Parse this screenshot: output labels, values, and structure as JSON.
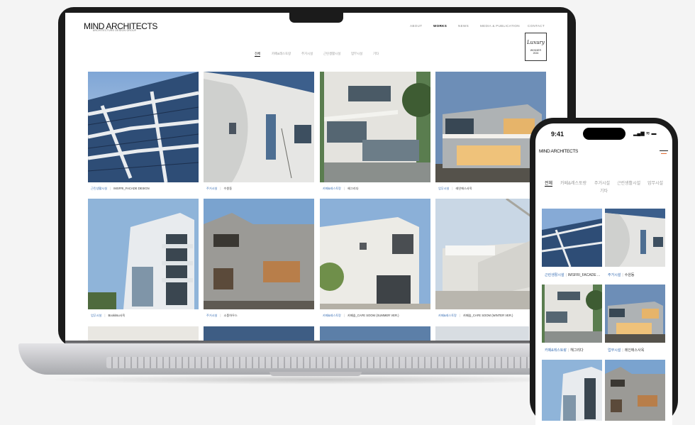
{
  "site": {
    "logo": "MIND ARCHITECTS",
    "logo_sub": "ARCHITECTURE DESIGN GROUP",
    "nav": [
      "ABOUT",
      "WORKS",
      "NEWS",
      "MEDIA & PUBLICATION",
      "CONTACT"
    ],
    "nav_active": "WORKS",
    "badge": {
      "script": "Luxury",
      "winner": "WINNER",
      "year": "2024"
    }
  },
  "filters": [
    "전체",
    "카페&레스토랑",
    "주거시설",
    "근린생활시설",
    "업무시설",
    "기타"
  ],
  "filter_active": "전체",
  "projects": [
    {
      "category": "근린생활시설",
      "title": "IMSFRI_FACADE DESIGN"
    },
    {
      "category": "주거시설",
      "title": "수원동"
    },
    {
      "category": "카페&레스토랑",
      "title": "헤그리다"
    },
    {
      "category": "업무시설",
      "title": "레인에스사옥"
    },
    {
      "category": "업무시설",
      "title": "Bookitsu사옥"
    },
    {
      "category": "주거시설",
      "title": "소풍하우스"
    },
    {
      "category": "카페&레스토랑",
      "title": "카페숨_CAFE SOOM (SUMMER VER.)"
    },
    {
      "category": "카페&레스토랑",
      "title": "카페숨_CAFE SOOM (WINTER VER.)"
    }
  ],
  "phone": {
    "time": "9:41",
    "status": "▂▄▆ ≋ ▬",
    "logo": "MIND ARCHITECTS",
    "filters_row1": [
      "전체",
      "카페&레스토랑",
      "주거시설",
      "근린생활시설",
      "업무시설"
    ],
    "filters_row2": [
      "기타"
    ],
    "projects": [
      {
        "category": "근린생활시설",
        "title": "IMSFRI_FACADE ..."
      },
      {
        "category": "주거시설",
        "title": "수원동"
      },
      {
        "category": "카페&레스토랑",
        "title": "헤그리다"
      },
      {
        "category": "업무시설",
        "title": "레인에스사옥"
      }
    ]
  }
}
